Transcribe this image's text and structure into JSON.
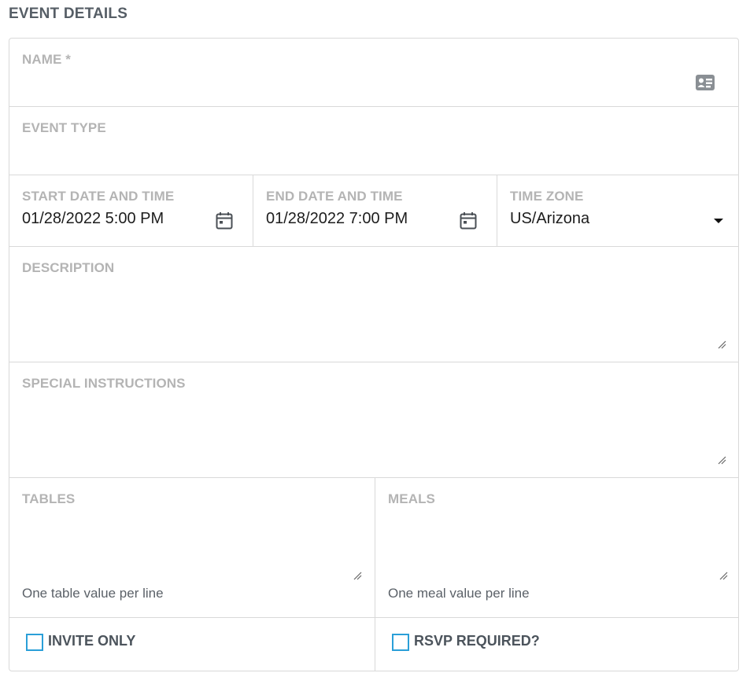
{
  "section": {
    "title": "EVENT DETAILS"
  },
  "fields": {
    "name": {
      "label": "NAME *",
      "value": "",
      "icon": "contact-card-icon"
    },
    "event_type": {
      "label": "EVENT TYPE",
      "value": ""
    },
    "start": {
      "label": "START DATE AND TIME",
      "value": "01/28/2022 5:00 PM",
      "icon": "calendar-icon"
    },
    "end": {
      "label": "END DATE AND TIME",
      "value": "01/28/2022 7:00 PM",
      "icon": "calendar-icon"
    },
    "timezone": {
      "label": "TIME ZONE",
      "value": "US/Arizona",
      "icon": "caret-down-icon"
    },
    "description": {
      "label": "DESCRIPTION",
      "value": ""
    },
    "special_instructions": {
      "label": "SPECIAL INSTRUCTIONS",
      "value": ""
    },
    "tables": {
      "label": "TABLES",
      "value": "",
      "hint": "One table value per line"
    },
    "meals": {
      "label": "MEALS",
      "value": "",
      "hint": "One meal value per line"
    },
    "invite_only": {
      "label": "INVITE ONLY",
      "checked": false
    },
    "rsvp_required": {
      "label": "RSVP REQUIRED?",
      "checked": false
    }
  },
  "colors": {
    "label": "#b4b4b4",
    "border": "#d9d9d9",
    "checkbox": "#2a9fd8",
    "title": "#565e66"
  }
}
